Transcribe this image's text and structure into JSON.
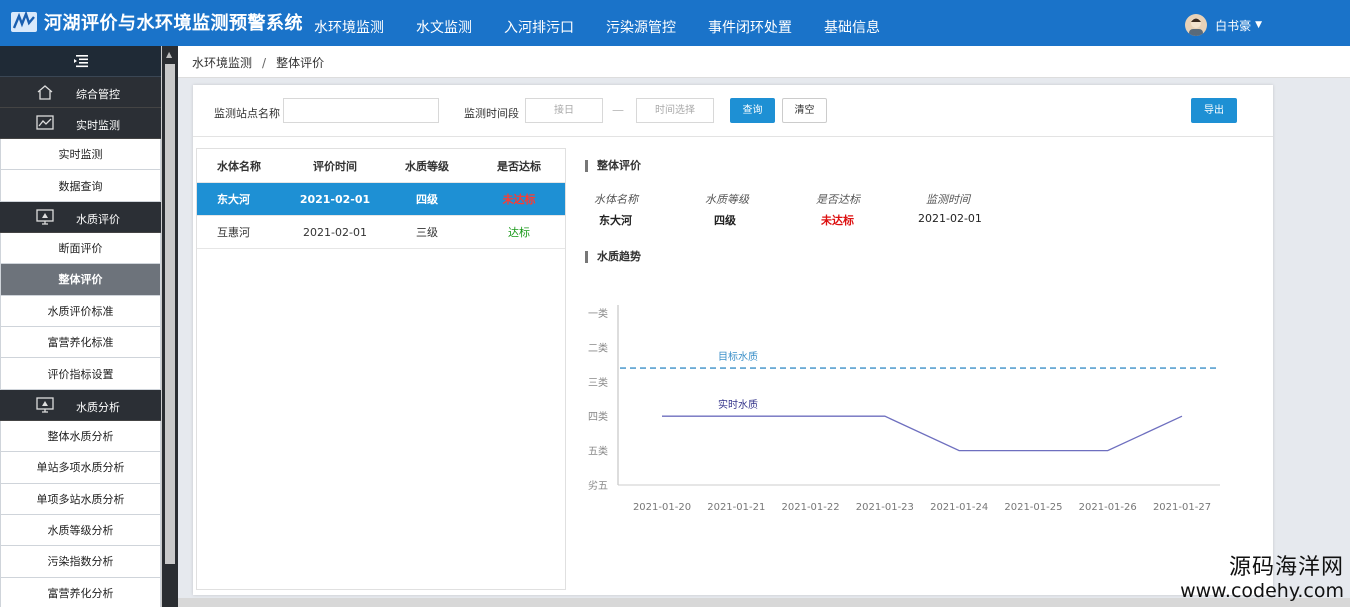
{
  "app": {
    "title": "河湖评价与水环境监测预警系统"
  },
  "nav": [
    {
      "label": "水环境监测"
    },
    {
      "label": "水文监测"
    },
    {
      "label": "入河排污口"
    },
    {
      "label": "污染源管控"
    },
    {
      "label": "事件闭环处置"
    },
    {
      "label": "基础信息"
    }
  ],
  "user": {
    "name": "白书豪"
  },
  "sidebar": {
    "toggle_icon": "menu-collapse-icon",
    "group_1": {
      "label": "综合管控",
      "icon": "home-icon"
    },
    "group_2": {
      "label": "实时监测",
      "icon": "line-chart-icon"
    },
    "group_2_items": [
      {
        "label": "实时监测"
      },
      {
        "label": "数据查询"
      }
    ],
    "group_3": {
      "label": "水质评价",
      "icon": "monitor-icon"
    },
    "group_3_items": [
      {
        "label": "断面评价"
      },
      {
        "label": "整体评价"
      },
      {
        "label": "水质评价标准"
      },
      {
        "label": "富营养化标准"
      },
      {
        "label": "评价指标设置"
      }
    ],
    "group_4": {
      "label": "水质分析",
      "icon": "monitor-icon"
    },
    "group_4_items": [
      {
        "label": "整体水质分析"
      },
      {
        "label": "单站多项水质分析"
      },
      {
        "label": "单项多站水质分析"
      },
      {
        "label": "水质等级分析"
      },
      {
        "label": "污染指数分析"
      },
      {
        "label": "富营养化分析"
      }
    ]
  },
  "breadcrumb": {
    "parent": "水环境监测",
    "separator": "/",
    "current": "整体评价"
  },
  "filter": {
    "station_label": "监测站点名称",
    "station_value": "",
    "time_label": "监测时间段",
    "start_placeholder": "接日",
    "end_placeholder": "时间选择",
    "query_button": "查询",
    "clear_button": "清空",
    "export_button": "导出"
  },
  "table": {
    "headers": [
      "水体名称",
      "评价时间",
      "水质等级",
      "是否达标"
    ],
    "rows": [
      {
        "name": "东大河",
        "date": "2021-02-01",
        "grade": "四级",
        "status": "未达标"
      },
      {
        "name": "互惠河",
        "date": "2021-02-01",
        "grade": "三级",
        "status": "达标"
      }
    ]
  },
  "summary": {
    "title": "整体评价",
    "headers": [
      "水体名称",
      "水质等级",
      "是否达标",
      "监测时间"
    ],
    "values": [
      "东大河",
      "四级",
      "未达标",
      "2021-02-01"
    ]
  },
  "trend": {
    "title": "水质趋势"
  },
  "chart_data": {
    "type": "line",
    "categories": [
      "2021-01-20",
      "2021-01-21",
      "2021-01-22",
      "2021-01-23",
      "2021-01-24",
      "2021-01-25",
      "2021-01-26",
      "2021-01-27"
    ],
    "y_categories": [
      "一类",
      "二类",
      "三类",
      "四类",
      "五类",
      "劣五"
    ],
    "series": [
      {
        "name": "实时水质",
        "values": [
          4,
          4,
          4,
          4,
          5,
          5,
          5,
          4
        ],
        "style": "solid",
        "color": "#6e6fbf"
      },
      {
        "name": "目标水质",
        "values": [
          2.6,
          2.6,
          2.6,
          2.6,
          2.6,
          2.6,
          2.6,
          2.6
        ],
        "style": "dashed",
        "color": "#3a8fc8"
      }
    ],
    "grid": false
  },
  "colors": {
    "header": "#1a73c9",
    "sidebar_group": "#2b2f35",
    "sidebar_active": "#6d737b",
    "primary_button": "#1e90d4",
    "selected_row": "#1e90d4",
    "fail": "#dd1111",
    "pass": "#1a9a1a"
  },
  "watermark": {
    "line1": "源码海洋网",
    "line2": "www.codehy.com"
  }
}
